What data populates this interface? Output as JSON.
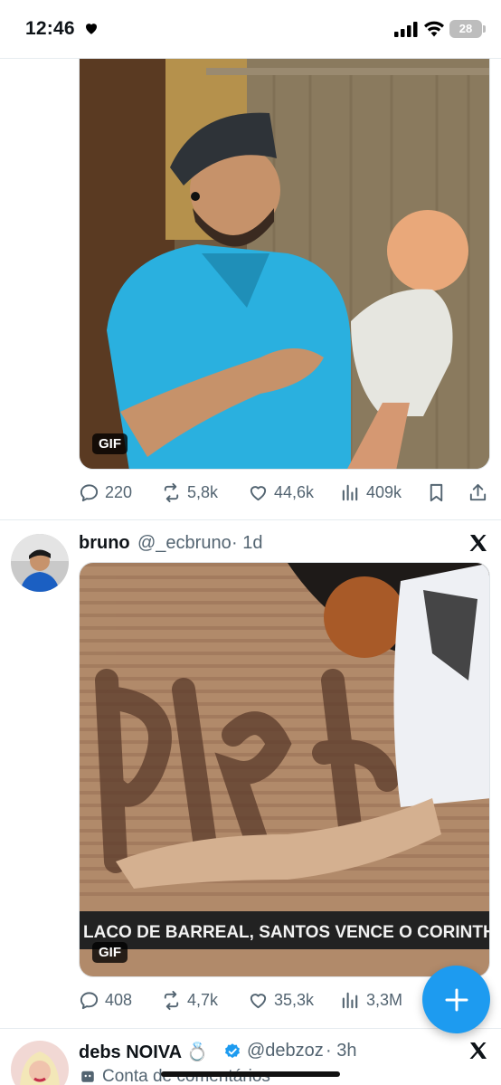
{
  "status_bar": {
    "time": "12:46",
    "battery": "28"
  },
  "tweets": [
    {
      "media_badge": "GIF",
      "stats": {
        "replies": "220",
        "reposts": "5,8k",
        "likes": "44,6k",
        "views": "409k"
      }
    },
    {
      "name": "bruno",
      "handle": "@_ecbruno",
      "time": "· 1d",
      "media_badge": "GIF",
      "media_caption": "LACO DE BARREAL, SANTOS VENCE O CORINTHI",
      "stats": {
        "replies": "408",
        "reposts": "4,7k",
        "likes": "35,3k",
        "views": "3,3M"
      }
    },
    {
      "name": "debs NOIVA 💍",
      "handle": "@debzoz",
      "time": "· 3h",
      "subtext": "Conta de comentários"
    }
  ],
  "icons": [
    "heart-icon",
    "signal-icon",
    "wifi-icon",
    "battery-icon",
    "reply-icon",
    "repost-icon",
    "like-icon",
    "views-icon",
    "bookmark-icon",
    "share-icon",
    "x-logo-icon",
    "verified-icon",
    "compose-icon"
  ],
  "colors": {
    "accent": "#1d9bf0",
    "muted_text": "#536471",
    "primary_text": "#0f1419"
  }
}
